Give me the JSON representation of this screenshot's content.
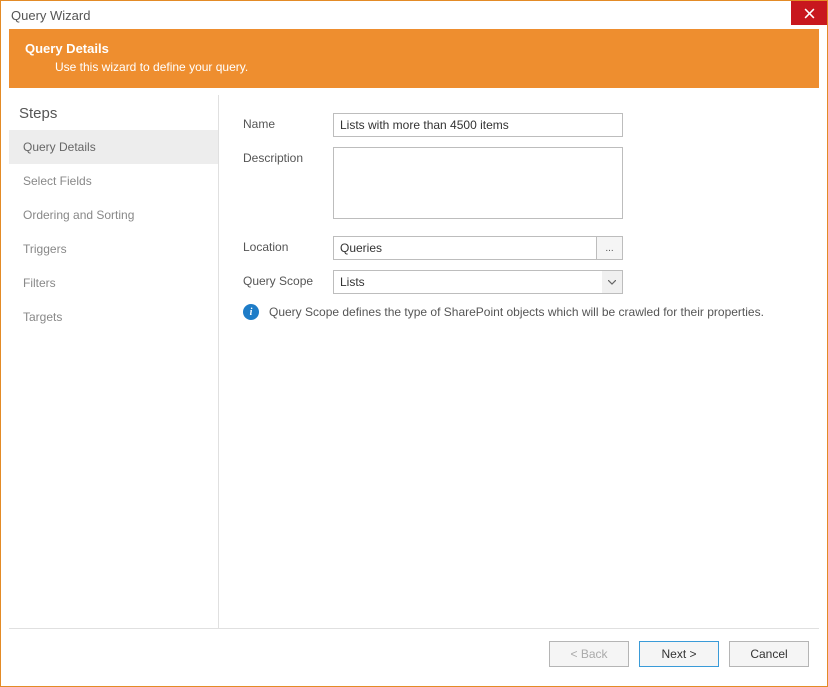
{
  "titlebar": {
    "title": "Query Wizard"
  },
  "header": {
    "title": "Query Details",
    "subtitle": "Use this wizard to define your query."
  },
  "sidebar": {
    "title": "Steps",
    "items": [
      {
        "label": "Query Details",
        "active": true
      },
      {
        "label": "Select Fields",
        "active": false
      },
      {
        "label": "Ordering and Sorting",
        "active": false
      },
      {
        "label": "Triggers",
        "active": false
      },
      {
        "label": "Filters",
        "active": false
      },
      {
        "label": "Targets",
        "active": false
      }
    ]
  },
  "form": {
    "name_label": "Name",
    "name_value": "Lists with more than 4500 items",
    "description_label": "Description",
    "description_value": "",
    "location_label": "Location",
    "location_value": "Queries",
    "location_browse": "...",
    "scope_label": "Query Scope",
    "scope_value": "Lists",
    "info_text": "Query Scope defines the type of SharePoint objects which will be crawled for their properties."
  },
  "footer": {
    "back": "< Back",
    "next": "Next >",
    "cancel": "Cancel"
  }
}
